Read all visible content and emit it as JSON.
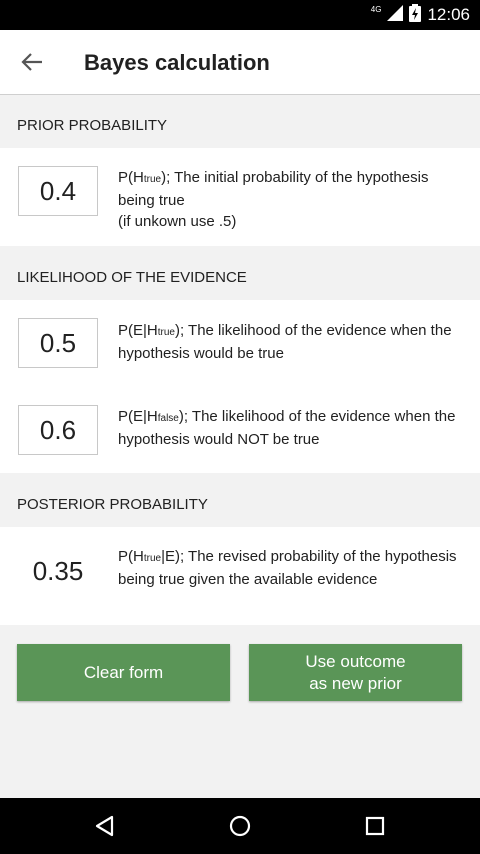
{
  "status_bar": {
    "time": "12:06",
    "network": "4G",
    "icons": [
      "signal-icon",
      "battery-icon"
    ]
  },
  "app_bar": {
    "title": "Bayes calculation",
    "back_icon": "arrow-back-icon"
  },
  "sections": {
    "prior": {
      "header": "PRIOR PROBABILITY",
      "value": "0.4",
      "desc": {
        "pre": "P(H",
        "sub": "true",
        "post": "); The initial probability of the hypothesis being true",
        "note": "(if unkown use .5)"
      }
    },
    "likelihood": {
      "header": "LIKELIHOOD OF THE EVIDENCE",
      "true": {
        "value": "0.5",
        "pre": "P(E|H",
        "sub": "true",
        "post": "); The likelihood of the evidence when the hypothesis would be true"
      },
      "false": {
        "value": "0.6",
        "pre": "P(E|H",
        "sub": "false",
        "post": "); The likelihood of the evidence when the hypothesis would NOT be true"
      }
    },
    "posterior": {
      "header": "POSTERIOR PROBABILITY",
      "value": "0.35",
      "pre": "P(H",
      "sub": "true",
      "post": "|E); The revised probability of the hypothesis being true given the available evidence"
    }
  },
  "buttons": {
    "clear": "Clear form",
    "use_outcome": "Use outcome\nas new prior",
    "color": "#5a9557"
  },
  "nav_bar": {
    "icons": [
      "back-triangle-icon",
      "home-circle-icon",
      "recents-square-icon"
    ]
  }
}
